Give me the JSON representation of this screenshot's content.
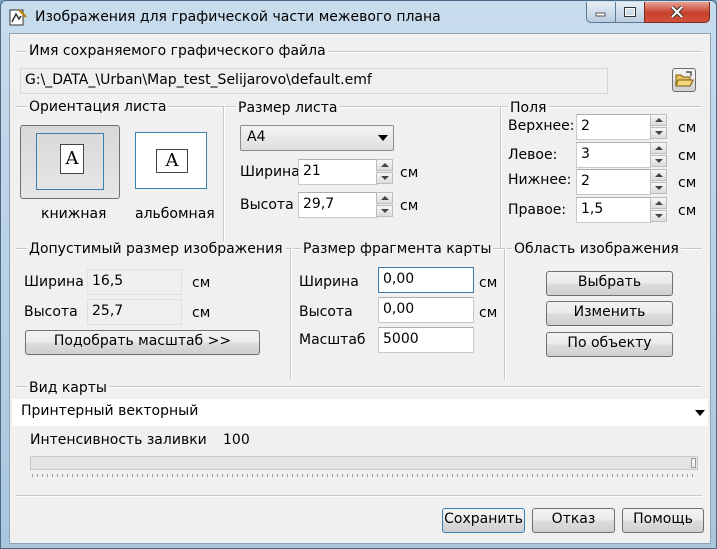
{
  "window": {
    "title": "Изображения для графической части межевого плана"
  },
  "file": {
    "label": "Имя сохраняемого графического файла",
    "path": "G:\\_DATA_\\Urban\\Map_test_Selijarovo\\default.emf"
  },
  "orientation": {
    "label": "Ориентация листа",
    "portrait_label": "книжная",
    "landscape_label": "альбомная",
    "glyph": "A"
  },
  "sheet_size": {
    "label": "Размер листа",
    "format": "A4",
    "width_label": "Ширина",
    "width_value": "21",
    "height_label": "Высота",
    "height_value": "29,7",
    "unit": "см"
  },
  "margins": {
    "label": "Поля",
    "top_label": "Верхнее:",
    "top_value": "2",
    "left_label": "Левое:",
    "left_value": "3",
    "bottom_label": "Нижнее:",
    "bottom_value": "2",
    "right_label": "Правое:",
    "right_value": "1,5",
    "unit": "см"
  },
  "allowed_size": {
    "label": "Допустимый размер изображения",
    "width_label": "Ширина",
    "width_value": "16,5",
    "height_label": "Высота",
    "height_value": "25,7",
    "unit": "см",
    "fit_button": "Подобрать масштаб >>"
  },
  "fragment": {
    "label": "Размер фрагмента карты",
    "width_label": "Ширина",
    "width_value": "0,00",
    "height_label": "Высота",
    "height_value": "0,00",
    "scale_label": "Масштаб",
    "scale_value": "5000",
    "unit": "см"
  },
  "area": {
    "label": "Область изображения",
    "select_button": "Выбрать",
    "change_button": "Изменить",
    "by_object_button": "По объекту"
  },
  "map_view": {
    "label": "Вид карты",
    "selected": "Принтерный векторный",
    "intensity_label": "Интенсивность заливки",
    "intensity_value": "100"
  },
  "footer": {
    "save": "Сохранить",
    "cancel": "Отказ",
    "help": "Помощь"
  }
}
